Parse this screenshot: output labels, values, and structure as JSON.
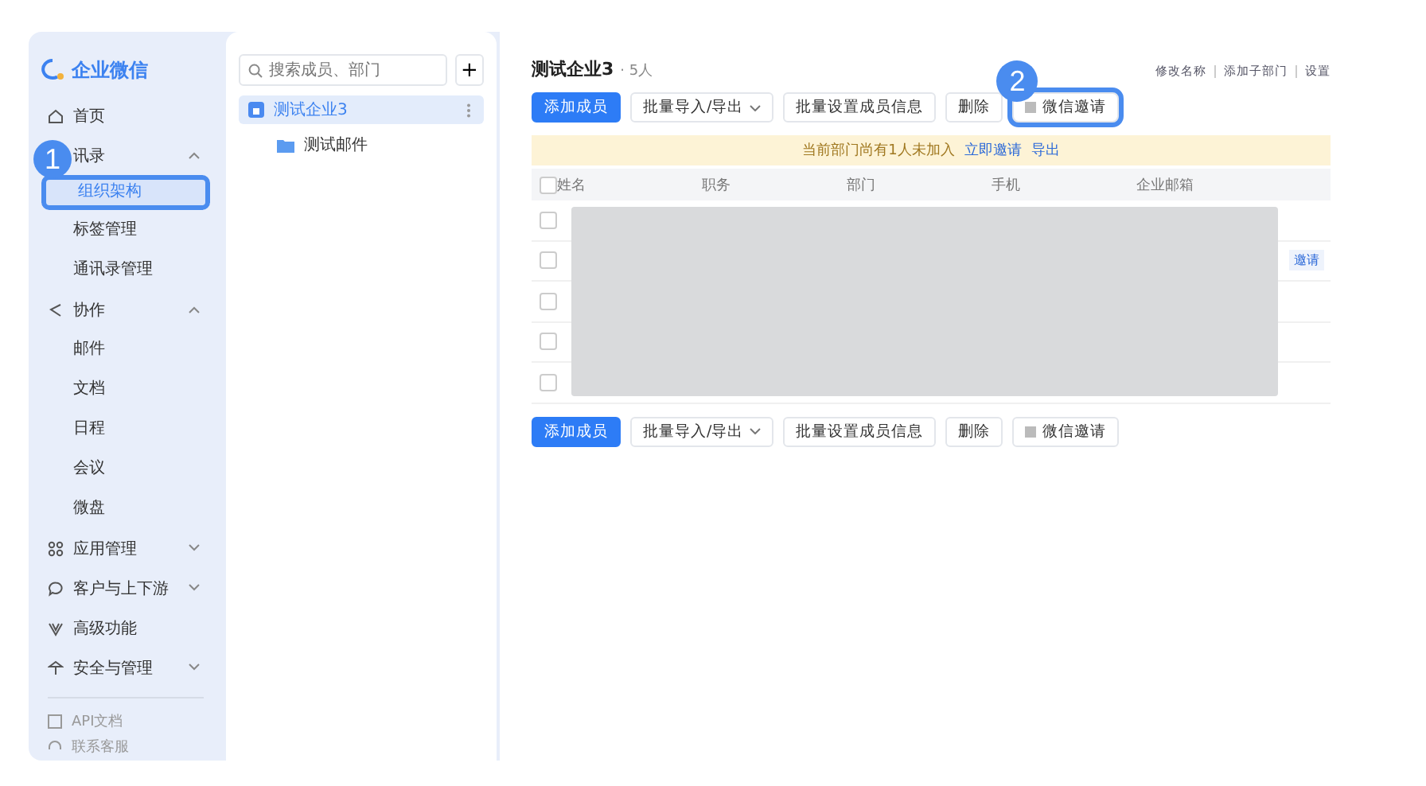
{
  "sidebar": {
    "logo": "企业微信",
    "items": [
      {
        "label": "首页",
        "selected": false
      },
      {
        "label": "讯录",
        "selected": false,
        "expanded": true,
        "children": [
          {
            "label": "组织架构",
            "selected": true
          },
          {
            "label": "标签管理",
            "selected": false
          },
          {
            "label": "通讯录管理",
            "selected": false
          }
        ]
      },
      {
        "label": "协作",
        "selected": false,
        "expanded": true,
        "children": [
          {
            "label": "邮件",
            "selected": false
          },
          {
            "label": "文档",
            "selected": false
          },
          {
            "label": "日程",
            "selected": false
          },
          {
            "label": "会议",
            "selected": false
          },
          {
            "label": "微盘",
            "selected": false
          }
        ]
      },
      {
        "label": "应用管理",
        "selected": false,
        "expanded": false
      },
      {
        "label": "客户与上下游",
        "selected": false,
        "expanded": false
      },
      {
        "label": "高级功能",
        "selected": false
      },
      {
        "label": "安全与管理",
        "selected": false,
        "expanded": false
      }
    ],
    "footer": [
      "API文档",
      "联系客服"
    ]
  },
  "tree": {
    "search": {
      "placeholder": "搜索成员、部门"
    },
    "add_button": "+",
    "items": [
      {
        "label": "测试企业3",
        "selected": true,
        "children": [
          {
            "label": "测试邮件",
            "selected": false
          }
        ]
      }
    ]
  },
  "main": {
    "title": "测试企业3",
    "count": "· 5人",
    "links": [
      "修改名称",
      "添加子部门",
      "设置"
    ],
    "toolbar_top": [
      {
        "label": "添加成员",
        "kind": "primary"
      },
      {
        "label": "批量导入/导出",
        "kind": "dropdown"
      },
      {
        "label": "批量设置成员信息",
        "kind": "plain"
      },
      {
        "label": "删除",
        "kind": "plain"
      },
      {
        "label": "微信邀请",
        "kind": "grid"
      }
    ],
    "banner": {
      "text": "当前部门尚有1人未加入",
      "links": [
        "立即邀请",
        "导出"
      ]
    },
    "table": {
      "select_all": {
        "checked": false
      },
      "columns": [
        "姓名",
        "职务",
        "部门",
        "手机",
        "企业邮箱"
      ],
      "redacted": true,
      "rows": [
        {
          "checked": false
        },
        {
          "checked": false,
          "action": "邀请"
        },
        {
          "checked": false
        },
        {
          "checked": false
        },
        {
          "checked": false
        }
      ]
    },
    "toolbar_bottom": [
      {
        "label": "添加成员",
        "kind": "primary"
      },
      {
        "label": "批量导入/导出",
        "kind": "dropdown"
      },
      {
        "label": "批量设置成员信息",
        "kind": "plain"
      },
      {
        "label": "删除",
        "kind": "plain"
      },
      {
        "label": "微信邀请",
        "kind": "grid"
      }
    ]
  },
  "annotations": [
    {
      "label": "1"
    },
    {
      "label": "2"
    }
  ]
}
